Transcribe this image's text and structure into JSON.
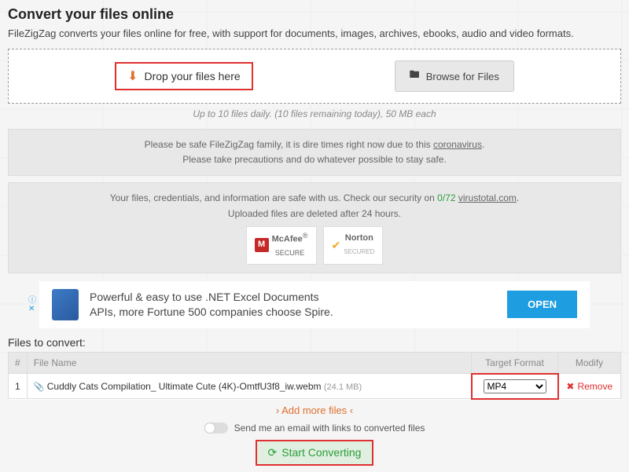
{
  "header": {
    "title": "Convert your files online",
    "subtitle": "FileZigZag converts your files online for free, with support for documents, images, archives, ebooks, audio and video formats."
  },
  "dropzone": {
    "drop_label": "Drop your files here",
    "browse_label": "Browse for Files"
  },
  "limits": "Up to 10 files daily. (10 files remaining today), 50 MB each",
  "notice": {
    "line1_pre": "Please be safe FileZigZag family, it is dire times right now due to this ",
    "line1_link": "coronavirus",
    "line1_post": ".",
    "line2": "Please take precautions and do whatever possible to stay safe.",
    "sec_pre": "Your files, credentials, and information are safe with us. Check our security on ",
    "sec_score": "0/72",
    "sec_link": "virustotal.com",
    "sec_post": ".",
    "uploaded": "Uploaded files are deleted after 24 hours."
  },
  "badges": {
    "mcafee": "McAfee",
    "mcafee_sub": "SECURE",
    "norton": "Norton",
    "norton_sub": "SECURED"
  },
  "ad": {
    "line1": "Powerful & easy to use .NET Excel Documents",
    "line2": "APIs, more Fortune 500 companies choose Spire.",
    "open": "OPEN"
  },
  "files": {
    "title": "Files to convert:",
    "col_num": "#",
    "col_name": "File Name",
    "col_target": "Target Format",
    "col_modify": "Modify",
    "rows": [
      {
        "num": "1",
        "name": "Cuddly Cats Compilation_ Ultimate Cute (4K)-OmtfU3f8_iw.webm",
        "size": "(24.1 MB)",
        "target": "MP4",
        "remove": "Remove"
      }
    ],
    "add_more": "Add more files"
  },
  "email_toggle": "Send me an email with links to converted files",
  "convert": "Start Converting"
}
